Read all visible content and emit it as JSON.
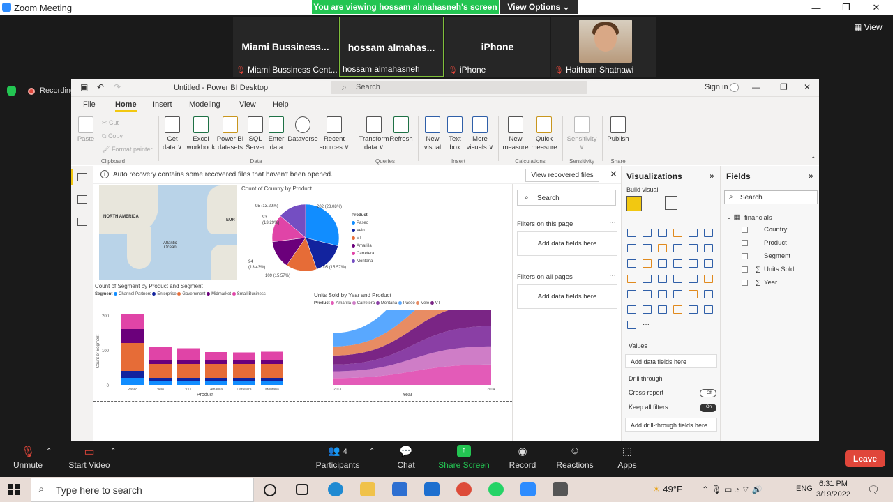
{
  "zoom": {
    "title": "Zoom Meeting",
    "share_banner": "You are viewing hossam almahasneh's screen",
    "view_options": "View Options",
    "view_button": "View",
    "recording": "Recording",
    "participants": [
      {
        "display": "Miami  Bussiness...",
        "name": "Miami Bussiness Cent..."
      },
      {
        "display": "hossam  almahas...",
        "name": "hossam almahasneh"
      },
      {
        "display": "iPhone",
        "name": "iPhone"
      },
      {
        "display": "",
        "name": "Haitham Shatnawi"
      }
    ],
    "toolbar": {
      "unmute": "Unmute",
      "start_video": "Start Video",
      "participants": "Participants",
      "participants_count": "4",
      "chat": "Chat",
      "share_screen": "Share Screen",
      "record": "Record",
      "reactions": "Reactions",
      "apps": "Apps",
      "leave": "Leave"
    }
  },
  "pbi": {
    "title": "Untitled - Power BI Desktop",
    "search_placeholder": "Search",
    "sign_in": "Sign in",
    "tabs": [
      "File",
      "Home",
      "Insert",
      "Modeling",
      "View",
      "Help"
    ],
    "ribbon": {
      "paste": "Paste",
      "cut": "Cut",
      "copy": "Copy",
      "format_painter": "Format painter",
      "get_data": "Get\ndata ∨",
      "excel": "Excel\nworkbook",
      "pbi_datasets": "Power BI\ndatasets",
      "sql": "SQL\nServer",
      "enter_data": "Enter\ndata",
      "dataverse": "Dataverse",
      "recent": "Recent\nsources ∨",
      "transform": "Transform\ndata ∨",
      "refresh": "Refresh",
      "new_visual": "New\nvisual",
      "text_box": "Text\nbox",
      "more_visuals": "More\nvisuals ∨",
      "new_measure": "New\nmeasure",
      "quick_measure": "Quick\nmeasure",
      "sensitivity": "Sensitivity\n∨",
      "publish": "Publish",
      "groups": [
        "Clipboard",
        "Data",
        "Queries",
        "Insert",
        "Calculations",
        "Sensitivity",
        "Share"
      ]
    },
    "notification": "Auto recovery contains some recovered files that haven't been opened.",
    "view_recovered": "View recovered files",
    "map": {
      "north_america": "NORTH AMERICA",
      "atlantic": "Atlantic\nOcean",
      "europe": "EUR"
    },
    "pie": {
      "title": "Count of Country by Product",
      "legend_title": "Product",
      "legend": [
        "Paseo",
        "Velo",
        "VTT",
        "Amarilla",
        "Carretera",
        "Montana"
      ],
      "legend_colors": [
        "#118dff",
        "#12239e",
        "#e66c37",
        "#6b007b",
        "#e044a7",
        "#744ec2"
      ],
      "labels": [
        "95 (13.29%)",
        "202 (28.08%)",
        "93\n(13.29%)",
        "94\n(13.43%)",
        "105 (15.57%)",
        "109 (15.57%)"
      ]
    },
    "stacked": {
      "title": "Count of Segment by Product and Segment",
      "legend_title": "Segment",
      "legend": [
        "Channel Partners",
        "Enterprise",
        "Government",
        "Midmarket",
        "Small Business"
      ],
      "ylabel": "Count of Segment",
      "xlabel": "Product",
      "yticks": [
        "200",
        "100",
        "0"
      ],
      "categories": [
        "Paseo",
        "Velo",
        "VTT",
        "Amarilla",
        "Carretera",
        "Montana"
      ]
    },
    "ribbonchart": {
      "title": "Units Sold by Year and Product",
      "legend_title": "Product",
      "legend": [
        "Amarilla",
        "Carretera",
        "Montana",
        "Paseo",
        "Velo",
        "VTT"
      ],
      "xlabel": "Year",
      "x_start": "2013",
      "x_end": "2014"
    },
    "filters": {
      "search": "Search",
      "on_page": "Filters on this page",
      "on_all": "Filters on all pages",
      "add_fields": "Add data fields here"
    },
    "viz": {
      "title": "Visualizations",
      "build": "Build visual",
      "values": "Values",
      "add_fields": "Add data fields here",
      "drill": "Drill through",
      "cross_report": "Cross-report",
      "cross_state": "Off",
      "keep_filters": "Keep all filters",
      "keep_state": "On",
      "add_drill": "Add drill-through fields here"
    },
    "fields": {
      "title": "Fields",
      "search": "Search",
      "table": "financials",
      "items": [
        "Country",
        "Product",
        "Segment",
        "Units Sold",
        "Year"
      ]
    }
  },
  "chart_data": [
    {
      "type": "pie",
      "title": "Count of Country by Product",
      "categories": [
        "Paseo",
        "Velo",
        "VTT",
        "Amarilla",
        "Carretera",
        "Montana"
      ],
      "values": [
        202,
        109,
        105,
        94,
        93,
        95
      ]
    },
    {
      "type": "bar",
      "title": "Count of Segment by Product and Segment",
      "categories": [
        "Paseo",
        "Velo",
        "VTT",
        "Amarilla",
        "Carretera",
        "Montana"
      ],
      "series": [
        {
          "name": "Channel Partners",
          "values": [
            20,
            10,
            10,
            10,
            10,
            10
          ]
        },
        {
          "name": "Enterprise",
          "values": [
            20,
            10,
            10,
            10,
            10,
            10
          ]
        },
        {
          "name": "Government",
          "values": [
            80,
            40,
            40,
            40,
            40,
            40
          ]
        },
        {
          "name": "Midmarket",
          "values": [
            40,
            10,
            10,
            10,
            10,
            10
          ]
        },
        {
          "name": "Small Business",
          "values": [
            42,
            39,
            35,
            24,
            23,
            25
          ]
        }
      ],
      "ylabel": "Count of Segment",
      "xlabel": "Product",
      "ylim": [
        0,
        200
      ]
    },
    {
      "type": "area",
      "title": "Units Sold by Year and Product",
      "x": [
        "2013",
        "2014"
      ],
      "series": [
        {
          "name": "Paseo",
          "values": [
            60,
            250
          ]
        },
        {
          "name": "Velo",
          "values": [
            40,
            110
          ]
        },
        {
          "name": "VTT",
          "values": [
            40,
            100
          ]
        },
        {
          "name": "Montana",
          "values": [
            30,
            90
          ]
        },
        {
          "name": "Carretera",
          "values": [
            30,
            80
          ]
        },
        {
          "name": "Amarilla",
          "values": [
            30,
            90
          ]
        }
      ],
      "xlabel": "Year"
    }
  ],
  "taskbar": {
    "search": "Type here to search",
    "weather": "49°F",
    "lang": "ENG",
    "time": "6:31 PM",
    "date": "3/19/2022"
  }
}
